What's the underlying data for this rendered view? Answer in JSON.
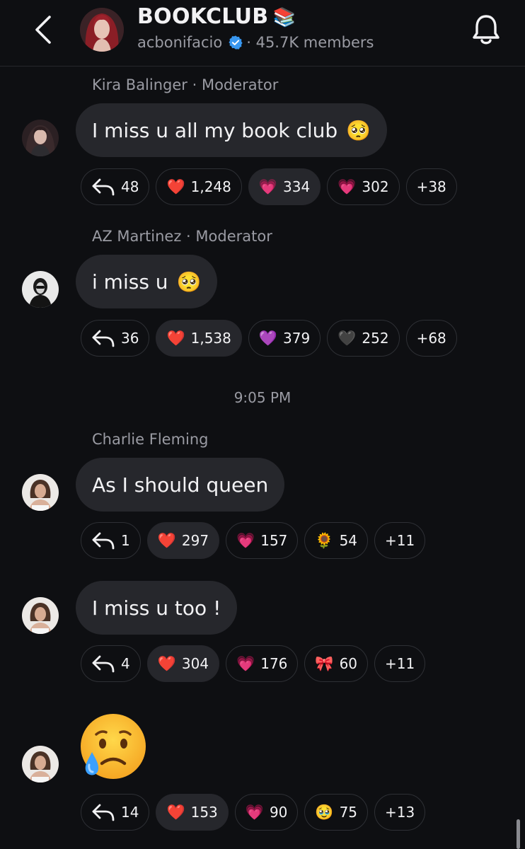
{
  "header": {
    "title": "BOOKCLUB",
    "title_emoji": "📚",
    "username": "acbonifacio",
    "members": "· 45.7K members"
  },
  "timestamp": "9:05 PM",
  "messages": [
    {
      "sender": "Kira Balinger · Moderator",
      "text": "I miss u all my book club",
      "emoji": "🥺",
      "reactions": [
        {
          "icon": "reply-icon",
          "count": "48"
        },
        {
          "icon": "❤️",
          "count": "1,248"
        },
        {
          "icon": "💗",
          "count": "334"
        },
        {
          "icon": "💗",
          "count": "302"
        },
        {
          "icon": "",
          "count": "+38"
        }
      ]
    },
    {
      "sender": "AZ Martinez · Moderator",
      "text": "i miss u",
      "emoji": "🥺",
      "reactions": [
        {
          "icon": "reply-icon",
          "count": "36"
        },
        {
          "icon": "❤️",
          "count": "1,538"
        },
        {
          "icon": "💜",
          "count": "379"
        },
        {
          "icon": "🖤",
          "count": "252"
        },
        {
          "icon": "",
          "count": "+68"
        }
      ]
    },
    {
      "sender": "Charlie Fleming",
      "text": "As I should queen",
      "reactions": [
        {
          "icon": "reply-icon",
          "count": "1"
        },
        {
          "icon": "❤️",
          "count": "297"
        },
        {
          "icon": "💗",
          "count": "157"
        },
        {
          "icon": "🌻",
          "count": "54"
        },
        {
          "icon": "",
          "count": "+11"
        }
      ]
    },
    {
      "text": "I miss u too !",
      "reactions": [
        {
          "icon": "reply-icon",
          "count": "4"
        },
        {
          "icon": "❤️",
          "count": "304"
        },
        {
          "icon": "💗",
          "count": "176"
        },
        {
          "icon": "🎀",
          "count": "60"
        },
        {
          "icon": "",
          "count": "+11"
        }
      ]
    },
    {
      "big_emoji": "crying-face",
      "reactions": [
        {
          "icon": "reply-icon",
          "count": "14"
        },
        {
          "icon": "❤️",
          "count": "153"
        },
        {
          "icon": "💗",
          "count": "90"
        },
        {
          "icon": "🥹",
          "count": "75"
        },
        {
          "icon": "",
          "count": "+13"
        }
      ]
    }
  ],
  "colors": {
    "background": "#0e0f12",
    "bubble": "#26272c",
    "muted_text": "#9a9ba3",
    "verified_blue": "#3897f0"
  }
}
